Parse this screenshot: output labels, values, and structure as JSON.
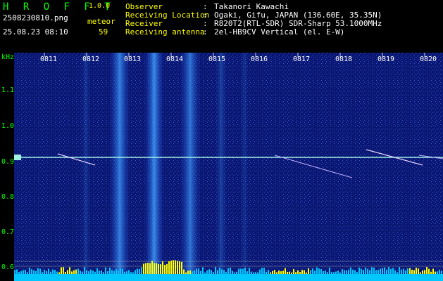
{
  "header": {
    "app_title": "H R O F F T",
    "app_version": "1.0.0",
    "file_name": "2508230810.png",
    "meteor_label": "meteor",
    "timestamp": "25.08.23 08:10",
    "meteor_count": "59",
    "info": [
      {
        "label": "Observer",
        "value": "Takanori Kawachi"
      },
      {
        "label": "Receiving Location",
        "value": "Ogaki, Gifu, JAPAN (136.60E, 35.35N)"
      },
      {
        "label": "Receiver",
        "value": "R820T2(RTL-SDR) SDR-Sharp 53.1000MHz"
      },
      {
        "label": "Receiving antenna",
        "value": "2el-HB9CV Vertical (el. E-W)"
      }
    ],
    "separator": ":"
  },
  "axis": {
    "unit": "kHz",
    "y_ticks": [
      "1.1",
      "1.0",
      "0.9",
      "0.8",
      "0.7",
      "0.6"
    ],
    "x_ticks": [
      "0811",
      "0812",
      "0813",
      "0814",
      "0815",
      "0816",
      "0817",
      "0818",
      "0819",
      "0820"
    ]
  },
  "colors": {
    "background": "#0a1670",
    "header_text": "#ffffff",
    "accent_green": "#00ff00",
    "accent_yellow": "#ffff00",
    "carrier_line": "#9ff0e0",
    "noise_band": "#40a0ff",
    "bottom_bar": "#00c8ff"
  }
}
